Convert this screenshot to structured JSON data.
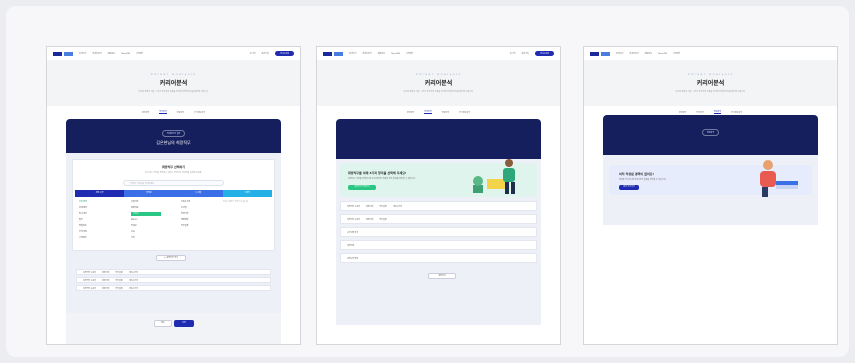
{
  "colors": {
    "navy": "#161f5e",
    "brand_blue": "#1f2bb0",
    "green": "#29c783",
    "sky": "#23b0e6",
    "mid_blue": "#3a6fe8"
  },
  "nav": {
    "items": [
      "검색하기",
      "커리어분석",
      "채용정보",
      "TalentDB",
      "고객센터"
    ],
    "right_items": [
      "로그인",
      "회원가입"
    ],
    "cta": "서비스문의"
  },
  "hero": {
    "eyebrow": "Career Analysis",
    "title": "커리어분석",
    "desc": "지금의 경험과 기술, 그리고 앞으로의 목표를 분석해 최적의 진로를 제안해 드립니다."
  },
  "tabs": [
    "경력분석",
    "직무분석",
    "진로탐색",
    "추가정보입력"
  ],
  "screens": {
    "s1": {
      "active_tab": 1,
      "banner_pill": "커리어분석 결과",
      "banner_name": "김은현님의 희망직무",
      "card_title": "희망직무 선택하기",
      "card_sub": "관심 있는 직무를 선택하고 원하는 방향으로 커리어를 설계해 보세요.",
      "search_placeholder": "직무명, 키워드를 검색하세요",
      "categories": [
        "경영·사무",
        "마케팅",
        "IT·개발",
        "디자인"
      ],
      "col1": [
        "기획·전략",
        "회계·재무",
        "인사·총무",
        "법무",
        "영업관리",
        "무역·유통",
        "고객관리"
      ],
      "col2": [
        "사업기획",
        "경영지원",
        "기획자",
        "PM·PO",
        "컨설팅",
        "교육",
        "기타"
      ],
      "col3": [
        "서비스기획",
        "신사업",
        "전략기획",
        "해외영업",
        "직무설정"
      ],
      "side_note": "최대 3개까지 선택 가능합니다",
      "more_button": "+ 희망직무 추가",
      "rows": [
        [
          "희망직무 1순위",
          "경영기획",
          "직무설정",
          "서비스기획"
        ],
        [
          "희망직무 2순위",
          "경영기획",
          "직무설정",
          "서비스기획"
        ],
        [
          "희망직무 3순위",
          "경영기획",
          "직무설정",
          "서비스기획"
        ]
      ],
      "cancel": "취소",
      "submit": "저장"
    },
    "s2": {
      "active_tab": 1,
      "promo_title": "희망직무를 아래 3가지 항목을 선택해 주세요!",
      "promo_desc": "희망하는 직무를 선택하시면 보다 정확한 커리어 분석 결과를 확인할 수 있습니다.",
      "promo_button": "희망직무 선택하기",
      "rows": [
        [
          "희망직무 1순위",
          "경영기획",
          "직무설정",
          "서비스기획"
        ],
        [
          "희망직무 2순위",
          "경영기획",
          "직무설정"
        ],
        [
          "근무희망지역"
        ],
        [
          "희망연봉"
        ],
        [
          "희망근무형태"
        ]
      ],
      "button": "저장하기"
    },
    "s3": {
      "active_tab": 2,
      "banner_pill": "진로탐색",
      "promo_title": "아직 작성된 경력이 없어요!",
      "promo_desc": "경력을 추가하시면 진로 탐색 결과를 확인할 수 있습니다.",
      "promo_button": "경력 추가하기"
    }
  }
}
